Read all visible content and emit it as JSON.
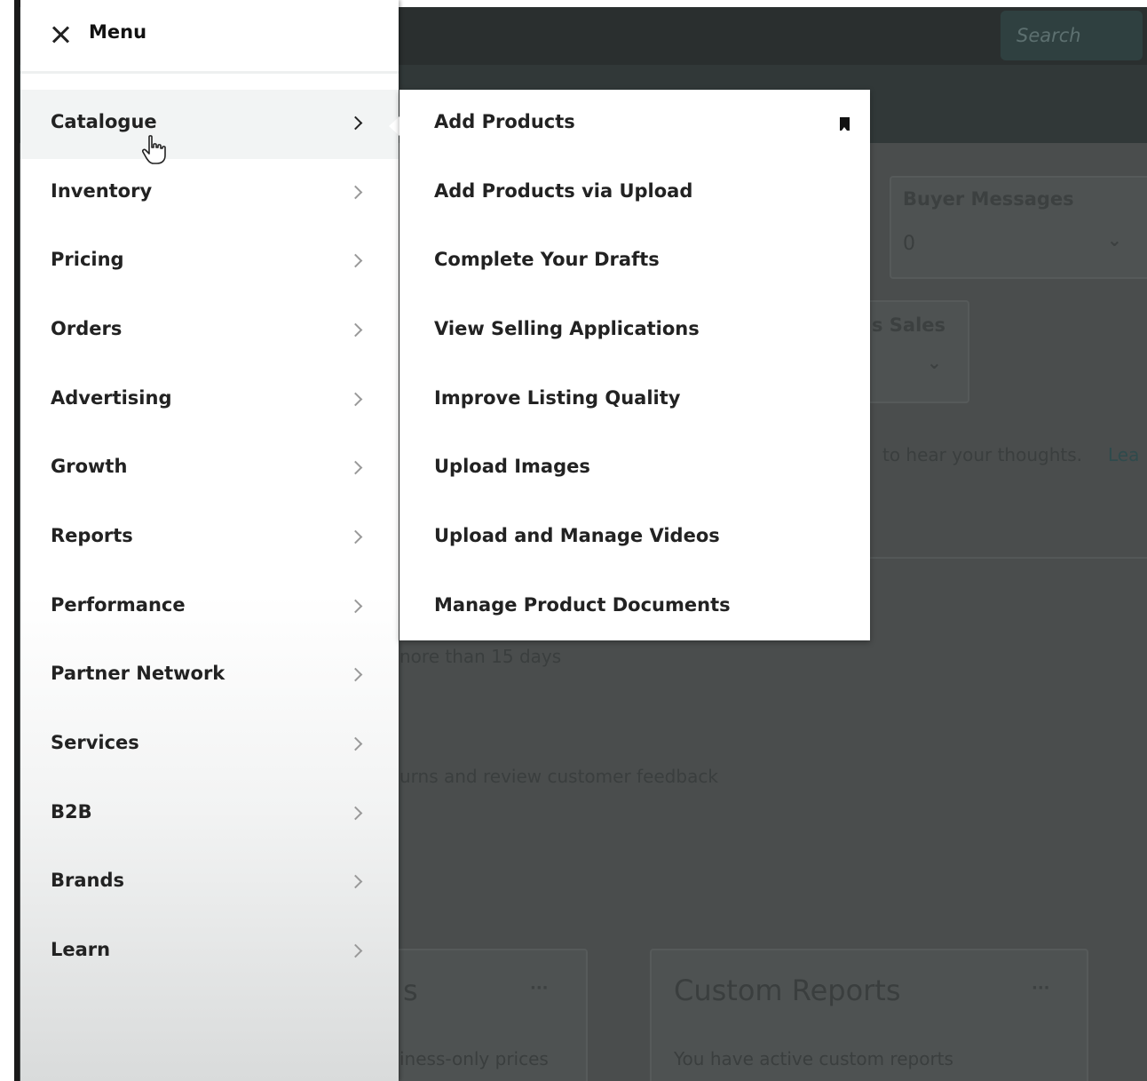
{
  "menu": {
    "title": "Menu",
    "items": [
      {
        "label": "Catalogue"
      },
      {
        "label": "Inventory"
      },
      {
        "label": "Pricing"
      },
      {
        "label": "Orders"
      },
      {
        "label": "Advertising"
      },
      {
        "label": "Growth"
      },
      {
        "label": "Reports"
      },
      {
        "label": "Performance"
      },
      {
        "label": "Partner Network"
      },
      {
        "label": "Services"
      },
      {
        "label": "B2B"
      },
      {
        "label": "Brands"
      },
      {
        "label": "Learn"
      }
    ]
  },
  "submenu": {
    "items": [
      {
        "label": "Add Products"
      },
      {
        "label": "Add Products via Upload"
      },
      {
        "label": "Complete Your Drafts"
      },
      {
        "label": "View Selling Applications"
      },
      {
        "label": "Improve Listing Quality"
      },
      {
        "label": "Upload Images"
      },
      {
        "label": "Upload and Manage Videos"
      },
      {
        "label": "Manage Product Documents"
      }
    ]
  },
  "background": {
    "search_label": "Search",
    "buyer_messages_title": "Buyer Messages",
    "buyer_messages_value": "0",
    "sales_partial": "s Sales",
    "feedback_text": "to hear your thoughts.",
    "feedback_link": "Lea",
    "days_text": "nore than 15 days",
    "returns_text": "urns and review customer feedback",
    "card_left_title_partial": "s",
    "card_left_text": "iness-only prices",
    "custom_reports_title": "Custom Reports",
    "custom_reports_text": "You have active custom reports",
    "more_label": "···"
  }
}
